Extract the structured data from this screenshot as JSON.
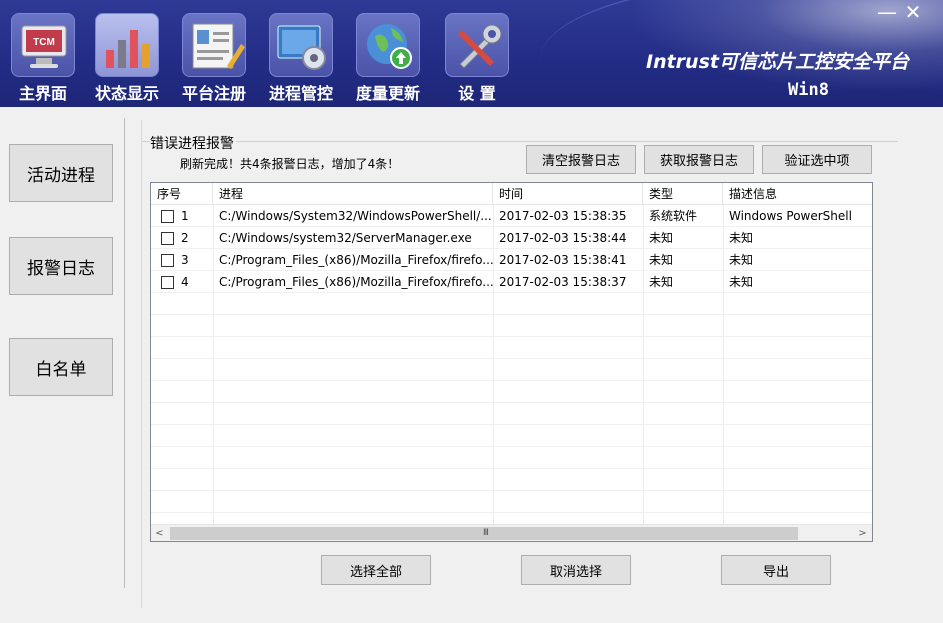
{
  "window": {
    "brand_title": "Intrust可信芯片工控安全平台",
    "brand_sub": "Win8",
    "minimize": "—",
    "close": "✕"
  },
  "nav": [
    {
      "label": "主界面",
      "icon": "tcm-monitor-icon"
    },
    {
      "label": "状态显示",
      "icon": "bar-chart-icon"
    },
    {
      "label": "平台注册",
      "icon": "registration-form-icon"
    },
    {
      "label": "进程管控",
      "icon": "process-gear-icon"
    },
    {
      "label": "度量更新",
      "icon": "globe-update-icon"
    },
    {
      "label": "设 置",
      "icon": "tools-settings-icon"
    }
  ],
  "tcm_icon_text": "TCM",
  "sidebar": [
    {
      "label": "活动进程"
    },
    {
      "label": "报警日志"
    },
    {
      "label": "白名单"
    }
  ],
  "panel": {
    "title": "错误进程报警",
    "status": "刷新完成！共4条报警日志，增加了4条！",
    "btn_clear": "清空报警日志",
    "btn_fetch": "获取报警日志",
    "btn_verify": "验证选中项"
  },
  "table": {
    "headers": [
      "序号",
      "进程",
      "时间",
      "类型",
      "描述信息"
    ],
    "rows": [
      {
        "num": "1",
        "process": "C:/Windows/System32/WindowsPowerShell/...",
        "time": "2017-02-03 15:38:35",
        "type": "系统软件",
        "desc": "Windows PowerShell",
        "checked": false
      },
      {
        "num": "2",
        "process": "C:/Windows/system32/ServerManager.exe",
        "time": "2017-02-03 15:38:44",
        "type": "未知",
        "desc": "未知",
        "checked": false
      },
      {
        "num": "3",
        "process": "C:/Program_Files_(x86)/Mozilla_Firefox/firefo...",
        "time": "2017-02-03 15:38:41",
        "type": "未知",
        "desc": "未知",
        "checked": false
      },
      {
        "num": "4",
        "process": "C:/Program_Files_(x86)/Mozilla_Firefox/firefo...",
        "time": "2017-02-03 15:38:37",
        "type": "未知",
        "desc": "未知",
        "checked": false
      }
    ],
    "scroll_left": "<",
    "scroll_right": ">",
    "scroll_grip": "III"
  },
  "footer": {
    "select_all": "选择全部",
    "deselect": "取消选择",
    "export": "导出"
  }
}
